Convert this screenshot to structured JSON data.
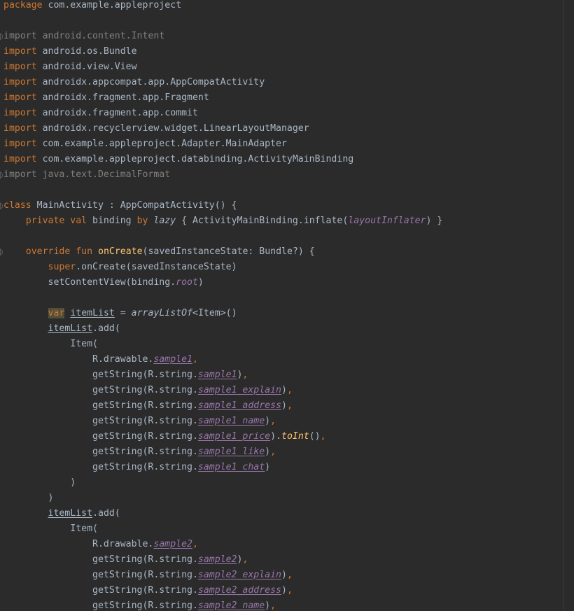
{
  "lines": [
    [
      {
        "t": "package",
        "c": "kw"
      },
      {
        "t": " com.example.appleproject",
        "c": "pl"
      }
    ],
    [],
    [
      {
        "t": "import",
        "c": "unused"
      },
      {
        "t": " android.content.Intent",
        "c": "unused"
      }
    ],
    [
      {
        "t": "import",
        "c": "kw"
      },
      {
        "t": " android.os.Bundle",
        "c": "pl"
      }
    ],
    [
      {
        "t": "import",
        "c": "kw"
      },
      {
        "t": " android.view.View",
        "c": "pl"
      }
    ],
    [
      {
        "t": "import",
        "c": "kw"
      },
      {
        "t": " androidx.appcompat.app.AppCompatActivity",
        "c": "pl"
      }
    ],
    [
      {
        "t": "import",
        "c": "kw"
      },
      {
        "t": " androidx.fragment.app.Fragment",
        "c": "pl"
      }
    ],
    [
      {
        "t": "import",
        "c": "kw"
      },
      {
        "t": " androidx.fragment.app.commit",
        "c": "pl"
      }
    ],
    [
      {
        "t": "import",
        "c": "kw"
      },
      {
        "t": " androidx.recyclerview.widget.LinearLayoutManager",
        "c": "pl"
      }
    ],
    [
      {
        "t": "import",
        "c": "kw"
      },
      {
        "t": " com.example.appleproject.Adapter.MainAdapter",
        "c": "pl"
      }
    ],
    [
      {
        "t": "import",
        "c": "kw"
      },
      {
        "t": " com.example.appleproject.databinding.ActivityMainBinding",
        "c": "pl"
      }
    ],
    [
      {
        "t": "import",
        "c": "unused"
      },
      {
        "t": " java.text.DecimalFormat",
        "c": "unused"
      }
    ],
    [],
    [
      {
        "t": "class",
        "c": "kw"
      },
      {
        "t": " MainActivity : AppCompatActivity() {",
        "c": "pl"
      }
    ],
    [
      {
        "t": "    ",
        "c": "pl"
      },
      {
        "t": "private val",
        "c": "kw"
      },
      {
        "t": " binding ",
        "c": "pl"
      },
      {
        "t": "by",
        "c": "kw"
      },
      {
        "t": " ",
        "c": "pl"
      },
      {
        "t": "lazy",
        "c": "fni"
      },
      {
        "t": " { ActivityMainBinding.inflate(",
        "c": "pl"
      },
      {
        "t": "layoutInflater",
        "c": "propi"
      },
      {
        "t": ") }",
        "c": "pl"
      }
    ],
    [],
    [
      {
        "t": "    ",
        "c": "pl"
      },
      {
        "t": "override fun",
        "c": "kw"
      },
      {
        "t": " ",
        "c": "pl"
      },
      {
        "t": "onCreate",
        "c": "fn"
      },
      {
        "t": "(savedInstanceState: Bundle?) {",
        "c": "pl"
      }
    ],
    [
      {
        "t": "        ",
        "c": "pl"
      },
      {
        "t": "super",
        "c": "kw"
      },
      {
        "t": ".onCreate(savedInstanceState)",
        "c": "pl"
      }
    ],
    [
      {
        "t": "        setContentView(binding.",
        "c": "pl"
      },
      {
        "t": "root",
        "c": "propi"
      },
      {
        "t": ")",
        "c": "pl"
      }
    ],
    [],
    [
      {
        "t": "        ",
        "c": "pl"
      },
      {
        "t": "var",
        "c": "varhl"
      },
      {
        "t": " ",
        "c": "pl"
      },
      {
        "t": "itemList",
        "c": "uline"
      },
      {
        "t": " = ",
        "c": "pl"
      },
      {
        "t": "arrayListOf",
        "c": "fni"
      },
      {
        "t": "<Item>()",
        "c": "pl"
      }
    ],
    [
      {
        "t": "        ",
        "c": "pl"
      },
      {
        "t": "itemList",
        "c": "uline"
      },
      {
        "t": ".add(",
        "c": "pl"
      }
    ],
    [
      {
        "t": "            Item(",
        "c": "pl"
      }
    ],
    [
      {
        "t": "                R.drawable.",
        "c": "pl"
      },
      {
        "t": "sample1",
        "c": "propui"
      },
      {
        "t": ",",
        "c": "punc"
      }
    ],
    [
      {
        "t": "                getString(R.string.",
        "c": "pl"
      },
      {
        "t": "sample1",
        "c": "propui"
      },
      {
        "t": ")",
        "c": "pl"
      },
      {
        "t": ",",
        "c": "punc"
      }
    ],
    [
      {
        "t": "                getString(R.string.",
        "c": "pl"
      },
      {
        "t": "sample1_explain",
        "c": "propui"
      },
      {
        "t": ")",
        "c": "pl"
      },
      {
        "t": ",",
        "c": "punc"
      }
    ],
    [
      {
        "t": "                getString(R.string.",
        "c": "pl"
      },
      {
        "t": "sample1_address",
        "c": "propui"
      },
      {
        "t": ")",
        "c": "pl"
      },
      {
        "t": ",",
        "c": "punc"
      }
    ],
    [
      {
        "t": "                getString(R.string.",
        "c": "pl"
      },
      {
        "t": "sample1_name",
        "c": "propui"
      },
      {
        "t": ")",
        "c": "pl"
      },
      {
        "t": ",",
        "c": "punc"
      }
    ],
    [
      {
        "t": "                getString(R.string.",
        "c": "pl"
      },
      {
        "t": "sample1_price",
        "c": "propui"
      },
      {
        "t": ").",
        "c": "pl"
      },
      {
        "t": "toInt",
        "c": "fnbi"
      },
      {
        "t": "()",
        "c": "pl"
      },
      {
        "t": ",",
        "c": "punc"
      }
    ],
    [
      {
        "t": "                getString(R.string.",
        "c": "pl"
      },
      {
        "t": "sample1_like",
        "c": "propui"
      },
      {
        "t": ")",
        "c": "pl"
      },
      {
        "t": ",",
        "c": "punc"
      }
    ],
    [
      {
        "t": "                getString(R.string.",
        "c": "pl"
      },
      {
        "t": "sample1_chat",
        "c": "propui"
      },
      {
        "t": ")",
        "c": "pl"
      }
    ],
    [
      {
        "t": "            )",
        "c": "pl"
      }
    ],
    [
      {
        "t": "        )",
        "c": "pl"
      }
    ],
    [
      {
        "t": "        ",
        "c": "pl"
      },
      {
        "t": "itemList",
        "c": "uline"
      },
      {
        "t": ".add(",
        "c": "pl"
      }
    ],
    [
      {
        "t": "            Item(",
        "c": "pl"
      }
    ],
    [
      {
        "t": "                R.drawable.",
        "c": "pl"
      },
      {
        "t": "sample2",
        "c": "propui"
      },
      {
        "t": ",",
        "c": "punc"
      }
    ],
    [
      {
        "t": "                getString(R.string.",
        "c": "pl"
      },
      {
        "t": "sample2",
        "c": "propui"
      },
      {
        "t": ")",
        "c": "pl"
      },
      {
        "t": ",",
        "c": "punc"
      }
    ],
    [
      {
        "t": "                getString(R.string.",
        "c": "pl"
      },
      {
        "t": "sample2_explain",
        "c": "propui"
      },
      {
        "t": ")",
        "c": "pl"
      },
      {
        "t": ",",
        "c": "punc"
      }
    ],
    [
      {
        "t": "                getString(R.string.",
        "c": "pl"
      },
      {
        "t": "sample2_address",
        "c": "propui"
      },
      {
        "t": ")",
        "c": "pl"
      },
      {
        "t": ",",
        "c": "punc"
      }
    ],
    [
      {
        "t": "                getString(R.string.",
        "c": "pl"
      },
      {
        "t": "sample2_name",
        "c": "propui"
      },
      {
        "t": ")",
        "c": "pl"
      },
      {
        "t": ",",
        "c": "punc"
      }
    ]
  ],
  "gutter_marks": [
    {
      "line": 2,
      "icon": "fold-marker-icon"
    },
    {
      "line": 11,
      "icon": "fold-marker-icon"
    },
    {
      "line": 13,
      "icon": "fold-marker-icon"
    },
    {
      "line": 16,
      "icon": "fold-marker-icon"
    }
  ]
}
